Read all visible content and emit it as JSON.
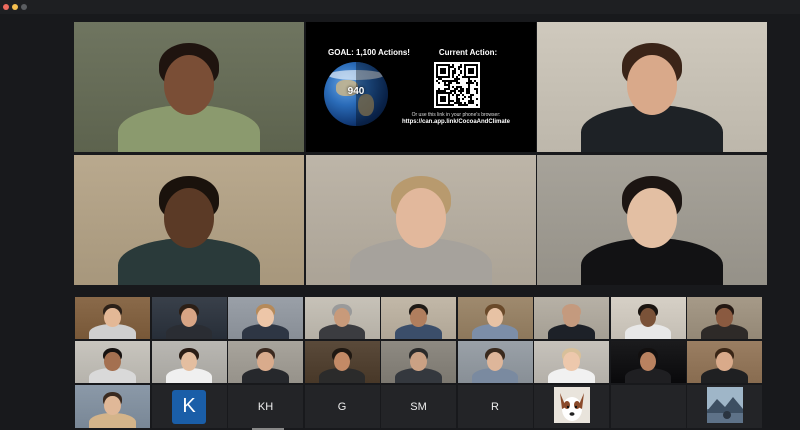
{
  "window": {
    "controls": [
      "close",
      "minimize",
      "disabled"
    ]
  },
  "main_tiles": [
    {
      "id": "p1",
      "room": "#6f7560",
      "skin": "#7a4e36",
      "hair": "#1f140f",
      "top": "#8b9a6e"
    },
    {
      "id": "presentation"
    },
    {
      "id": "p3",
      "room": "#cfc9bd",
      "skin": "#d9a98a",
      "hair": "#3a2418",
      "top": "#1e2226"
    },
    {
      "id": "p4",
      "room": "#b9a98e",
      "skin": "#5b3a26",
      "hair": "#1a120c",
      "top": "#2a3a3a"
    },
    {
      "id": "p5",
      "room": "#bdb5a8",
      "skin": "#e2b89c",
      "hair": "#b89a6e",
      "top": "#a6a29c"
    },
    {
      "id": "p6",
      "room": "#a7a39a",
      "skin": "#e3bfa3",
      "hair": "#1c1512",
      "top": "#121214"
    }
  ],
  "presentation": {
    "goal_label": "GOAL: 1,100 Actions!",
    "current_label": "Current Action:",
    "counter": "940",
    "hint": "Or use this link in your phone's browser:",
    "link": "https://can.app.link/CocoaAndClimate",
    "icons": {
      "globe": "earth-globe-icon",
      "qr": "qr-code-icon"
    }
  },
  "gallery_rows": [
    [
      {
        "room": "#8a6a4a",
        "skin": "#e3b896",
        "hair": "#2b2018",
        "top": "#cfcfcf"
      },
      {
        "room": "#39404a",
        "skin": "#d8a585",
        "hair": "#2c1f16",
        "top": "#2a2d33"
      },
      {
        "room": "#9aa0a8",
        "skin": "#edc6a8",
        "hair": "#b58a5a",
        "top": "#2e3644"
      },
      {
        "room": "#c7c2b8",
        "skin": "#c89a7a",
        "hair": "#9a9a9a",
        "top": "#3b3c40"
      },
      {
        "room": "#c2b8a8",
        "skin": "#b07e5e",
        "hair": "#1e1a16",
        "top": "#3b4e6a"
      },
      {
        "room": "#9f8a6e",
        "skin": "#e7c2a4",
        "hair": "#6a4a2a",
        "top": "#7c8ea8"
      },
      {
        "room": "#b7b1a6",
        "skin": "#c49a7e",
        "hair": "#c49a7e",
        "top": "#1d2128"
      },
      {
        "room": "#d6d0c6",
        "skin": "#7a5238",
        "hair": "#1a1410",
        "top": "#e8e8e8"
      },
      {
        "room": "#a69a88",
        "skin": "#8a5a40",
        "hair": "#241812",
        "top": "#2e2a28"
      }
    ],
    [
      {
        "room": "#c8c5be",
        "skin": "#a47050",
        "hair": "#161210",
        "top": "#d9d9d9"
      },
      {
        "room": "#b9b7b2",
        "skin": "#e4bea0",
        "hair": "#2a1d16",
        "top": "#f0f0f0"
      },
      {
        "room": "#a8a49c",
        "skin": "#d9ab8c",
        "hair": "#3c2a20",
        "top": "#26282c"
      },
      {
        "room": "#5a4a3a",
        "skin": "#c38a66",
        "hair": "#1f1812",
        "top": "#2b2b2b"
      },
      {
        "room": "#8e8a82",
        "skin": "#caa184",
        "hair": "#2a2a2a",
        "top": "#34383e"
      },
      {
        "room": "#9aa1a8",
        "skin": "#deb69a",
        "hair": "#3a2a1e",
        "top": "#7a8aa0"
      },
      {
        "room": "#c6c2bb",
        "skin": "#edc8ac",
        "hair": "#d8c09a",
        "top": "#f1f1f1"
      },
      {
        "room": "#1b1b1d",
        "skin": "#b98260",
        "hair": "#121010",
        "top": "#1f1f22"
      },
      {
        "room": "#9a7e62",
        "skin": "#d9aa8a",
        "hair": "#3a2616",
        "top": "#1f2022"
      }
    ]
  ],
  "bottom_row": {
    "photo_first": {
      "room": "#8b99a8",
      "skin": "#e0b898",
      "hair": "#3a2a20",
      "top": "#d4b48a"
    },
    "k_badge": "K",
    "names": [
      "KH",
      "G",
      "SM",
      "R"
    ],
    "dog_icon": "dog-avatar-icon",
    "mountain_icon": "mountain-landscape-icon"
  },
  "colors": {
    "background": "#18191c",
    "tile_name_bg": "#232427",
    "badge_blue": "#1a5ea8"
  }
}
